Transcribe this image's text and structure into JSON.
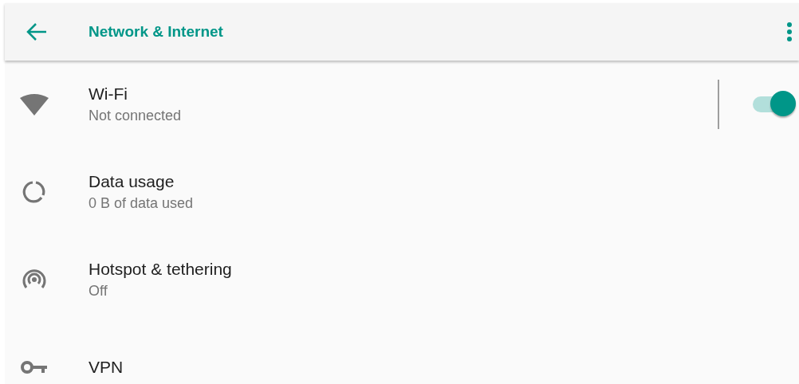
{
  "header": {
    "title": "Network & Internet"
  },
  "items": [
    {
      "kind": "toggle",
      "title": "Wi-Fi",
      "subtitle": "Not connected",
      "on": true
    },
    {
      "kind": "plain",
      "title": "Data usage",
      "subtitle": "0 B of data used"
    },
    {
      "kind": "plain",
      "title": "Hotspot & tethering",
      "subtitle": "Off"
    },
    {
      "kind": "plain",
      "title": "VPN"
    }
  ]
}
